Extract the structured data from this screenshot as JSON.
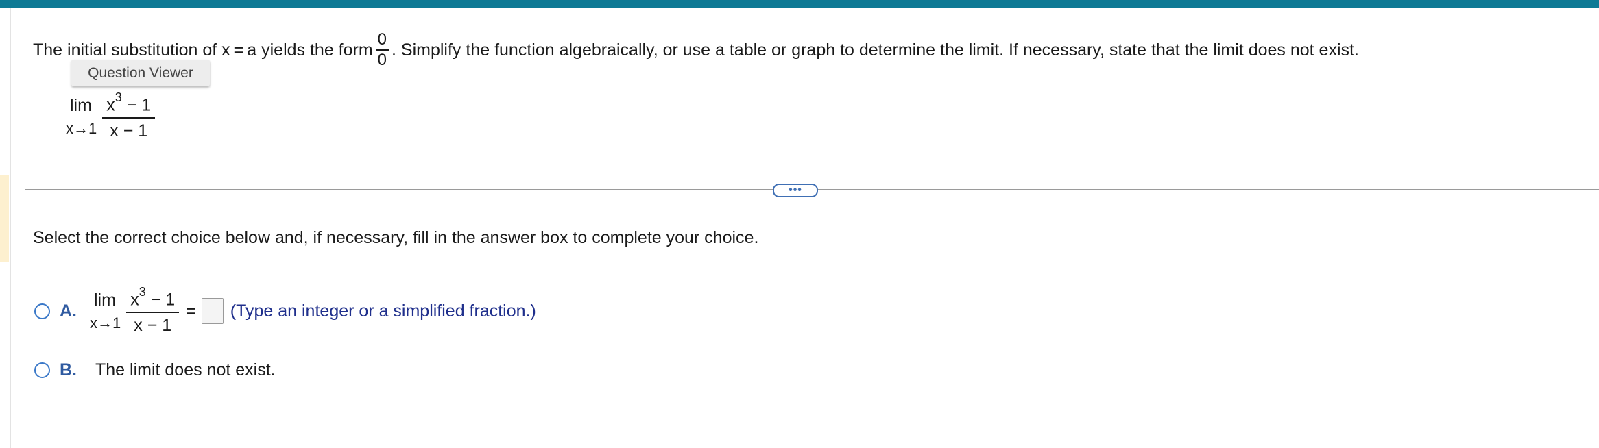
{
  "instruction": {
    "before": "The initial substitution of x = a yields the form",
    "frac_num": "0",
    "frac_den": "0",
    "after": ". Simplify the function algebraically, or use a table or graph to determine the limit. If necessary, state that the limit does not exist."
  },
  "question_viewer_label": "Question Viewer",
  "problem": {
    "lim": "lim",
    "sub": "x→1",
    "num_base": "x",
    "num_exp": "3",
    "num_rest": " − 1",
    "den": "x − 1"
  },
  "more_button_label": "•••",
  "prompt": "Select the correct choice below and, if necessary, fill in the answer box to complete your choice.",
  "choices": {
    "a": {
      "letter": "A.",
      "lim": "lim",
      "sub": "x→1",
      "num_base": "x",
      "num_exp": "3",
      "num_rest": " − 1",
      "den": "x − 1",
      "equals": "=",
      "answer_value": "",
      "hint": "(Type an integer or a simplified fraction.)"
    },
    "b": {
      "letter": "B.",
      "text": "The limit does not exist."
    }
  },
  "colors": {
    "top_bar": "#0e7a95",
    "choice_letter": "#2f5aa0",
    "hint_text": "#1f2f8c",
    "radio_border": "#3a78c8"
  }
}
